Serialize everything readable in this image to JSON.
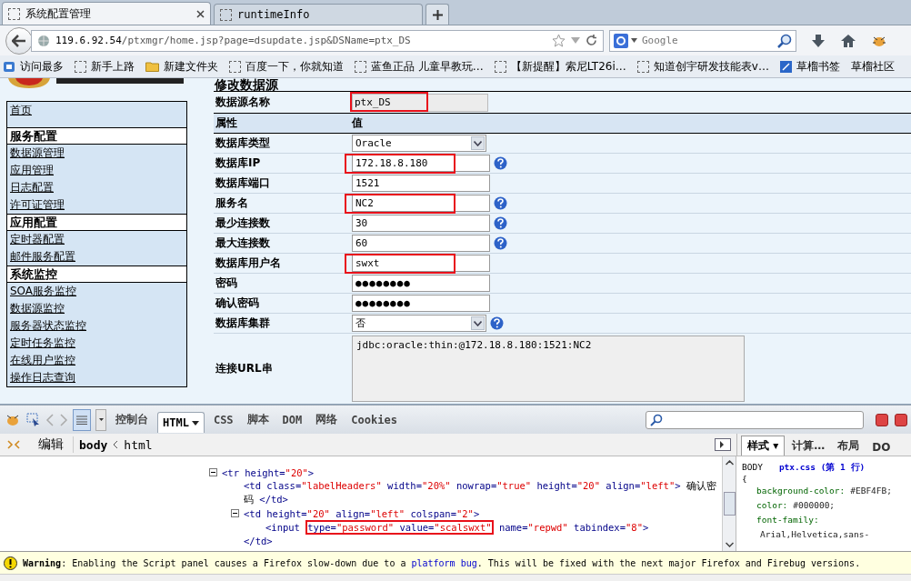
{
  "tabs": [
    {
      "title": "系统配置管理",
      "selected": true
    },
    {
      "title": "runtimeInfo",
      "selected": false
    }
  ],
  "address": {
    "host": "119.6.92.54",
    "path": "/ptxmgr/home.jsp?page=dsupdate.jsp&DSName=ptx_DS"
  },
  "search": {
    "placeholder": "Google"
  },
  "bookmarks": [
    {
      "label": "访问最多",
      "kind": "bookmarks"
    },
    {
      "label": "新手上路",
      "kind": "page"
    },
    {
      "label": "新建文件夹",
      "kind": "folder"
    },
    {
      "label": "百度一下，你就知道",
      "kind": "page"
    },
    {
      "label": "蓝鱼正品 儿童早教玩…",
      "kind": "page"
    },
    {
      "label": "【新提醒】索尼LT26i…",
      "kind": "page"
    },
    {
      "label": "知道创宇研发技能表v…",
      "kind": "page"
    },
    {
      "label": "草榴书签",
      "kind": "note"
    },
    {
      "label": "草榴社区",
      "kind": "text"
    }
  ],
  "sidebar": [
    {
      "label": "首页",
      "kind": "link"
    },
    {
      "label": "服务配置",
      "kind": "header"
    },
    {
      "label": "数据源管理",
      "kind": "link"
    },
    {
      "label": "应用管理",
      "kind": "link"
    },
    {
      "label": "日志配置",
      "kind": "link"
    },
    {
      "label": "许可证管理",
      "kind": "link"
    },
    {
      "label": "应用配置",
      "kind": "header"
    },
    {
      "label": "定时器配置",
      "kind": "link"
    },
    {
      "label": "邮件服务配置",
      "kind": "link"
    },
    {
      "label": "系统监控",
      "kind": "header"
    },
    {
      "label": "SOA服务监控",
      "kind": "link"
    },
    {
      "label": "数据源监控",
      "kind": "link"
    },
    {
      "label": "服务器状态监控",
      "kind": "link"
    },
    {
      "label": "定时任务监控",
      "kind": "link"
    },
    {
      "label": "在线用户监控",
      "kind": "link"
    },
    {
      "label": "操作日志查询",
      "kind": "link"
    }
  ],
  "form": {
    "title": "修改数据源",
    "name_label": "数据源名称",
    "name_value": "ptx_DS",
    "name_highlighted": true,
    "col_property": "属性",
    "col_value": "值",
    "rows": [
      {
        "label": "数据库类型",
        "kind": "select",
        "value": "Oracle",
        "help": false,
        "highlighted": false
      },
      {
        "label": "数据库IP",
        "kind": "text",
        "value": "172.18.8.180",
        "help": true,
        "highlighted": true
      },
      {
        "label": "数据库端口",
        "kind": "text",
        "value": "1521",
        "help": false,
        "highlighted": false
      },
      {
        "label": "服务名",
        "kind": "text",
        "value": "NC2",
        "help": true,
        "highlighted": true
      },
      {
        "label": "最少连接数",
        "kind": "text",
        "value": "30",
        "help": true,
        "highlighted": false
      },
      {
        "label": "最大连接数",
        "kind": "text",
        "value": "60",
        "help": true,
        "highlighted": false
      },
      {
        "label": "数据库用户名",
        "kind": "text",
        "value": "swxt",
        "help": false,
        "highlighted": true
      },
      {
        "label": "密码",
        "kind": "password",
        "value": "●●●●●●●●",
        "help": false,
        "highlighted": false
      },
      {
        "label": "确认密码",
        "kind": "password",
        "value": "●●●●●●●●",
        "help": false,
        "highlighted": false
      },
      {
        "label": "数据库集群",
        "kind": "select",
        "value": "否",
        "help": true,
        "highlighted": false
      },
      {
        "label": "连接URL串",
        "kind": "textarea",
        "value": "jdbc:oracle:thin:@172.18.8.180:1521:NC2",
        "help": false,
        "highlighted": false
      }
    ]
  },
  "firebug": {
    "tabs": [
      {
        "label": "控制台",
        "selected": false
      },
      {
        "label": "HTML",
        "selected": true
      },
      {
        "label": "CSS",
        "selected": false
      },
      {
        "label": "脚本",
        "selected": false
      },
      {
        "label": "DOM",
        "selected": false
      },
      {
        "label": "网络",
        "selected": false
      },
      {
        "label": "Cookies",
        "selected": false
      }
    ],
    "edit": "编辑",
    "breadcrumb": [
      {
        "label": "body",
        "selected": true
      },
      {
        "label": "html",
        "selected": false
      }
    ],
    "code": [
      {
        "expanded": true,
        "parts": [
          {
            "kind": "tag",
            "text": "<tr "
          },
          {
            "kind": "attr",
            "text": "height="
          },
          {
            "kind": "val",
            "text": "\"20\""
          },
          {
            "kind": "tag",
            "text": ">"
          }
        ],
        "children": [
          {
            "parts": [
              {
                "kind": "tag",
                "text": "<td "
              },
              {
                "kind": "attr",
                "text": "class="
              },
              {
                "kind": "val",
                "text": "\"labelHeaders\""
              },
              {
                "kind": "attr",
                "text": " width="
              },
              {
                "kind": "val",
                "text": "\"20%\""
              },
              {
                "kind": "attr",
                "text": " nowrap="
              },
              {
                "kind": "val",
                "text": "\"true\""
              },
              {
                "kind": "attr",
                "text": " height="
              },
              {
                "kind": "val",
                "text": "\"20\""
              },
              {
                "kind": "attr",
                "text": " align="
              },
              {
                "kind": "val",
                "text": "\"left\""
              },
              {
                "kind": "tag",
                "text": ">"
              },
              {
                "kind": "text",
                "text": " 确认密"
              }
            ]
          },
          {
            "parts": [
              {
                "kind": "text",
                "text": "码 "
              },
              {
                "kind": "tag",
                "text": "</td>"
              }
            ]
          },
          {
            "expanded": true,
            "parts": [
              {
                "kind": "tag",
                "text": "<td "
              },
              {
                "kind": "attr",
                "text": "height="
              },
              {
                "kind": "val",
                "text": "\"20\""
              },
              {
                "kind": "attr",
                "text": " align="
              },
              {
                "kind": "val",
                "text": "\"left\""
              },
              {
                "kind": "attr",
                "text": " colspan="
              },
              {
                "kind": "val",
                "text": "\"2\""
              },
              {
                "kind": "tag",
                "text": ">"
              }
            ],
            "children": [
              {
                "parts": [
                  {
                    "kind": "tag",
                    "text": "<input "
                  },
                  {
                    "kind": "attr",
                    "text": "type=",
                    "highlighted": true
                  },
                  {
                    "kind": "val",
                    "text": "\"password\"",
                    "highlighted": true
                  },
                  {
                    "kind": "attr",
                    "text": " value=",
                    "highlighted": true
                  },
                  {
                    "kind": "val",
                    "text": "\"scalswxt\"",
                    "highlighted": true
                  },
                  {
                    "kind": "attr",
                    "text": " name="
                  },
                  {
                    "kind": "val",
                    "text": "\"repwd\""
                  },
                  {
                    "kind": "attr",
                    "text": " tabindex="
                  },
                  {
                    "kind": "val",
                    "text": "\"8\""
                  },
                  {
                    "kind": "tag",
                    "text": ">"
                  }
                ]
              }
            ]
          },
          {
            "parts": [
              {
                "kind": "tag",
                "text": "</td>"
              }
            ]
          }
        ]
      }
    ],
    "side_tabs": [
      {
        "label": "样式 ▾",
        "selected": true
      },
      {
        "label": "计算…",
        "selected": false
      },
      {
        "label": "布局",
        "selected": false
      },
      {
        "label": "DO",
        "selected": false
      }
    ],
    "css_selector": "BODY",
    "css_source": "ptx.css (第 1 行)",
    "css_open": "{",
    "css_props": [
      {
        "name": "background-color:",
        "value": "#EBF4FB;"
      },
      {
        "name": "color:",
        "value": "#000000;"
      },
      {
        "name": "font-family:"
      },
      {
        "value": "Arial,Helvetica,sans-"
      }
    ],
    "warning": {
      "label": "Warning",
      "text": ": Enabling the Script panel causes a Firefox slow-down due to a ",
      "link": "platform bug",
      "after": ". This will be fixed with the next major Firefox and Firebug versions."
    }
  }
}
